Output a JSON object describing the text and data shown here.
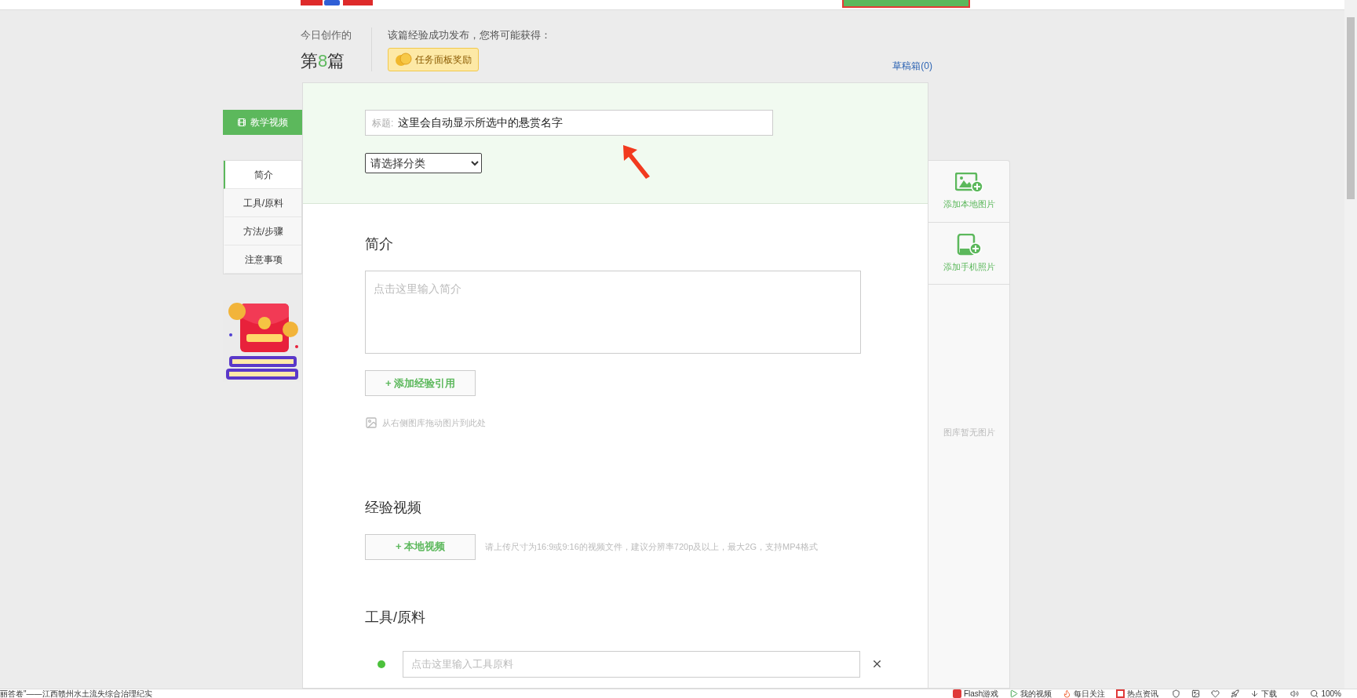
{
  "stats": {
    "label": "今日创作的",
    "prefix": "第",
    "count": "8",
    "suffix": "篇"
  },
  "reward": {
    "intro": "该篇经验成功发布，您将可能获得：",
    "badge": "任务面板奖励"
  },
  "drafts": "草稿箱(0)",
  "tutorial_button": "教学视频",
  "nav": [
    {
      "label": "简介",
      "selected": true
    },
    {
      "label": "工具/原料",
      "selected": false
    },
    {
      "label": "方法/步骤",
      "selected": false
    },
    {
      "label": "注意事项",
      "selected": false
    }
  ],
  "title_field": {
    "label": "标题:",
    "value": "这里会自动显示所选中的悬赏名字"
  },
  "category_select": "请选择分类",
  "intro": {
    "heading": "简介",
    "placeholder": "点击这里输入简介",
    "cite_button": "+ 添加经验引用",
    "drag_hint": "从右侧图库拖动图片到此处"
  },
  "video": {
    "heading": "经验视频",
    "button": "+ 本地视频",
    "hint": "请上传尺寸为16:9或9:16的视频文件，建议分辨率720p及以上，最大2G，支持MP4格式"
  },
  "tools": {
    "heading": "工具/原料",
    "placeholder": "点击这里输入工具原料"
  },
  "gallery": {
    "actions": [
      {
        "kind": "local",
        "label": "添加本地图片"
      },
      {
        "kind": "phone",
        "label": "添加手机照片"
      }
    ],
    "empty": "图库暂无图片"
  },
  "status_bar": {
    "headline": "丽答卷\"——江西赣州水土流失综合治理纪实",
    "items": [
      {
        "kind": "flash",
        "label": "Flash游戏"
      },
      {
        "kind": "video",
        "label": "我的视频"
      },
      {
        "kind": "hot",
        "label": "每日关注"
      },
      {
        "kind": "news",
        "label": "热点资讯"
      },
      {
        "kind": "download",
        "label": "下载"
      },
      {
        "kind": "zoom",
        "label": "100%"
      }
    ]
  }
}
